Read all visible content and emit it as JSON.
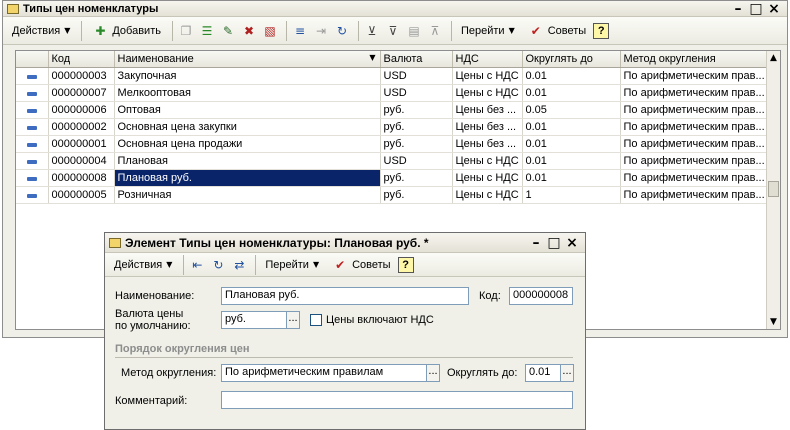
{
  "main_window": {
    "title": "Типы цен номенклатуры",
    "toolbar": {
      "actions": "Действия",
      "add": "Добавить",
      "goto": "Перейти",
      "tips": "Советы",
      "help": "?"
    },
    "columns": [
      "Код",
      "Наименование",
      "Валюта",
      "НДС",
      "Округлять до",
      "Метод округления"
    ],
    "rows": [
      {
        "code": "000000003",
        "name": "Закупочная",
        "currency": "USD",
        "vat": "Цены с НДС",
        "round": "0.01",
        "method": "По арифметическим прав..."
      },
      {
        "code": "000000007",
        "name": "Мелкооптовая",
        "currency": "USD",
        "vat": "Цены с НДС",
        "round": "0.01",
        "method": "По арифметическим прав..."
      },
      {
        "code": "000000006",
        "name": "Оптовая",
        "currency": "руб.",
        "vat": "Цены без ...",
        "round": "0.05",
        "method": "По арифметическим прав..."
      },
      {
        "code": "000000002",
        "name": "Основная цена закупки",
        "currency": "руб.",
        "vat": "Цены без ...",
        "round": "0.01",
        "method": "По арифметическим прав..."
      },
      {
        "code": "000000001",
        "name": "Основная цена продажи",
        "currency": "руб.",
        "vat": "Цены без ...",
        "round": "0.01",
        "method": "По арифметическим прав..."
      },
      {
        "code": "000000004",
        "name": "Плановая",
        "currency": "USD",
        "vat": "Цены с НДС",
        "round": "0.01",
        "method": "По арифметическим прав..."
      },
      {
        "code": "000000008",
        "name": "Плановая руб.",
        "currency": "руб.",
        "vat": "Цены с НДС",
        "round": "0.01",
        "method": "По арифметическим прав..."
      },
      {
        "code": "000000005",
        "name": "Розничная",
        "currency": "руб.",
        "vat": "Цены с НДС",
        "round": "1",
        "method": "По арифметическим прав..."
      }
    ]
  },
  "dialog": {
    "title": "Элемент Типы цен номенклатуры: Плановая руб. *",
    "toolbar": {
      "actions": "Действия",
      "goto": "Перейти",
      "tips": "Советы",
      "help": "?"
    },
    "name_label": "Наименование:",
    "name_value": "Плановая руб.",
    "code_label": "Код:",
    "code_value": "000000008",
    "currency_label_1": "Валюта цены",
    "currency_label_2": "по умолчанию:",
    "currency_value": "руб.",
    "vat_checkbox_label": "Цены включают НДС",
    "section_title": "Порядок округления цен",
    "method_label": "Метод округления:",
    "method_value": "По арифметическим правилам",
    "round_label": "Округлять до:",
    "round_value": "0.01",
    "comment_label": "Комментарий:",
    "comment_value": ""
  }
}
